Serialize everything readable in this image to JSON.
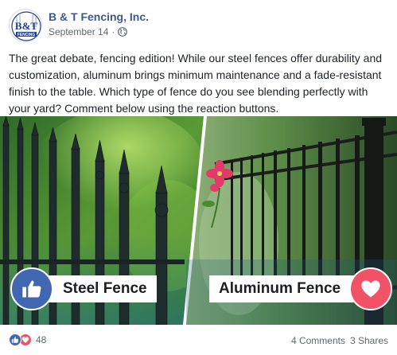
{
  "header": {
    "page_name": "B & T Fencing, Inc.",
    "date": "September 14",
    "separator": "·",
    "logo_text_top": "B&T",
    "logo_text_bottom": "FENCING"
  },
  "post": {
    "text": "The great debate, fencing edition! While our steel fences offer durability and customization, aluminum brings minimum maintenance and a fade-resistant finish to the table. Which type of fence do you see blending perfectly with your yard? Comment below using the reaction buttons."
  },
  "media": {
    "left_label": "Steel Fence",
    "right_label": "Aluminum Fence",
    "left_reaction_icon": "thumbs-up-icon",
    "right_reaction_icon": "heart-icon"
  },
  "footer": {
    "reaction_count": "48",
    "comments": "4 Comments",
    "shares": "3 Shares"
  },
  "colors": {
    "brand_blue": "#385898",
    "like_blue": "#4267b2",
    "love_red": "#f25268",
    "meta_gray": "#616770"
  }
}
